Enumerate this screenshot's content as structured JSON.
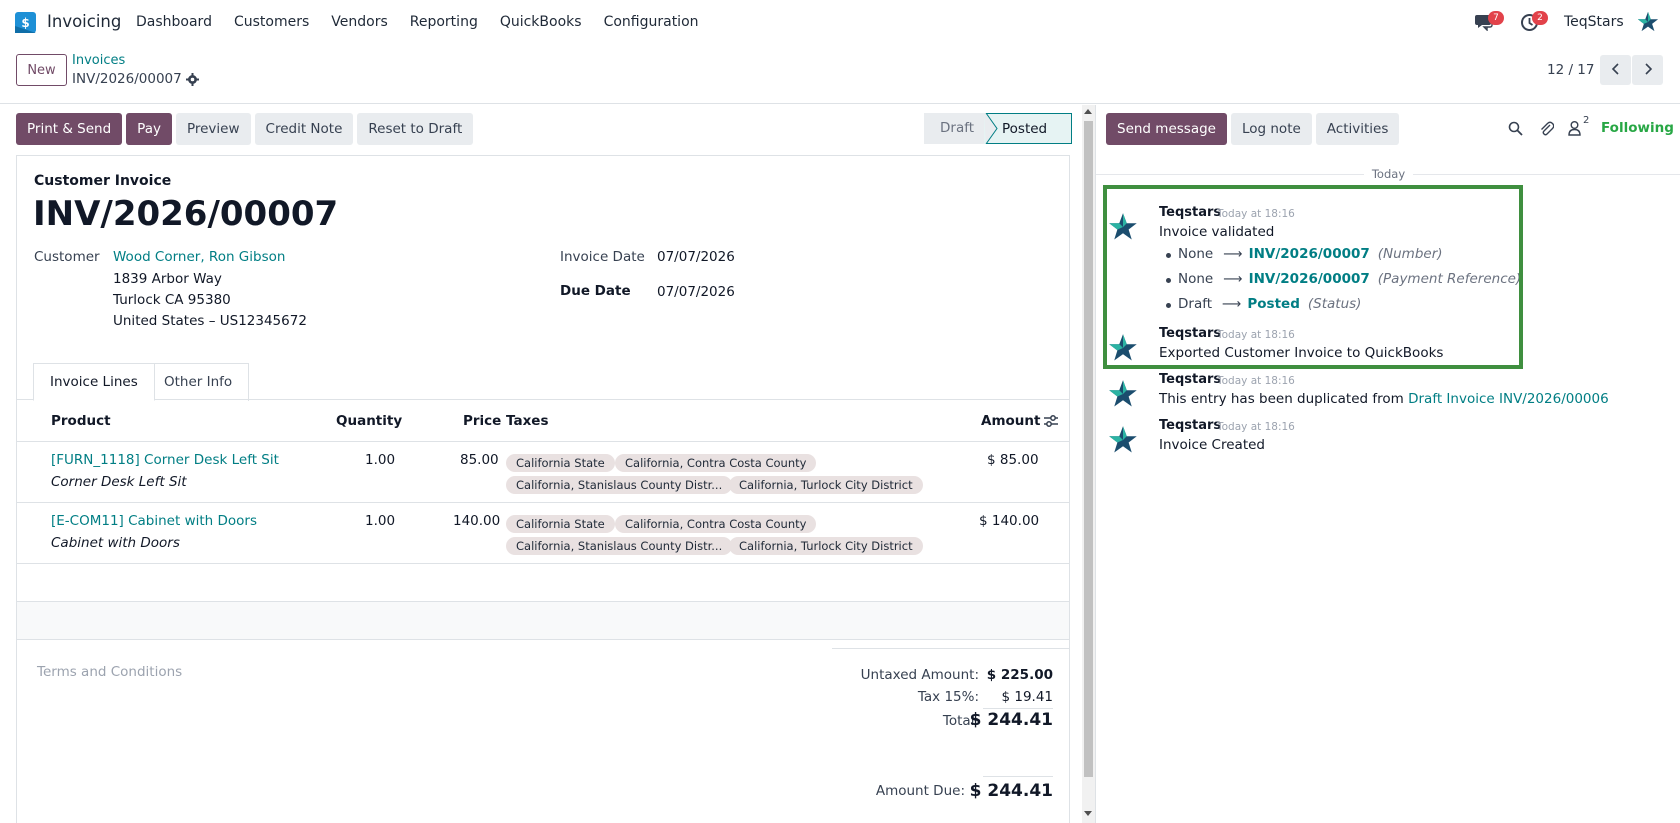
{
  "app": {
    "name": "Invoicing",
    "accent": "#714b67",
    "link_color": "#017e84"
  },
  "menu": [
    "Dashboard",
    "Customers",
    "Vendors",
    "Reporting",
    "QuickBooks",
    "Configuration"
  ],
  "systray": {
    "messages_count": "7",
    "activities_count": "2",
    "user": "TeqStars"
  },
  "control": {
    "new_label": "New",
    "breadcrumb_parent": "Invoices",
    "breadcrumb_current": "INV/2026/00007",
    "pager": "12 / 17"
  },
  "form_actions": {
    "print_send": "Print & Send",
    "pay": "Pay",
    "preview": "Preview",
    "credit_note": "Credit Note",
    "reset_draft": "Reset to Draft"
  },
  "status": {
    "draft": "Draft",
    "posted": "Posted"
  },
  "invoice": {
    "type": "Customer Invoice",
    "number": "INV/2026/00007",
    "customer_label": "Customer",
    "customer_name": "Wood Corner, Ron Gibson",
    "address": [
      "1839 Arbor Way",
      "Turlock CA 95380",
      "United States – US12345672"
    ],
    "invoice_date_label": "Invoice Date",
    "invoice_date": "07/07/2026",
    "due_date_label": "Due Date",
    "due_date": "07/07/2026"
  },
  "tabs": {
    "lines": "Invoice Lines",
    "other": "Other Info"
  },
  "columns": {
    "product": "Product",
    "quantity": "Quantity",
    "price": "Price",
    "taxes": "Taxes",
    "amount": "Amount"
  },
  "lines": [
    {
      "product": "[FURN_1118] Corner Desk Left Sit",
      "description": "Corner Desk Left Sit",
      "quantity": "1.00",
      "price": "85.00",
      "taxes": [
        "California State",
        "California, Contra Costa County",
        "California, Stanislaus County Distr...",
        "California, Turlock City District"
      ],
      "amount": "$ 85.00"
    },
    {
      "product": "[E-COM11] Cabinet with Doors",
      "description": "Cabinet with Doors",
      "quantity": "1.00",
      "price": "140.00",
      "taxes": [
        "California State",
        "California, Contra Costa County",
        "California, Stanislaus County Distr...",
        "California, Turlock City District"
      ],
      "amount": "$ 140.00"
    }
  ],
  "terms_placeholder": "Terms and Conditions",
  "totals": {
    "untaxed_label": "Untaxed Amount:",
    "untaxed": "$ 225.00",
    "tax_label": "Tax 15%:",
    "tax": "$ 19.41",
    "total_label": "Total:",
    "total": "$ 244.41",
    "due_label": "Amount Due:",
    "due": "$ 244.41"
  },
  "chatter": {
    "send_message": "Send message",
    "log_note": "Log note",
    "activities": "Activities",
    "followers_count": "2",
    "following": "Following",
    "date_separator": "Today",
    "messages": [
      {
        "author": "Teqstars",
        "time": "Today at 18:16",
        "body": "Invoice validated",
        "tracking": [
          {
            "old": "None",
            "new": "INV/2026/00007",
            "field": "(Number)"
          },
          {
            "old": "None",
            "new": "INV/2026/00007",
            "field": "(Payment Reference)"
          },
          {
            "old": "Draft",
            "new": "Posted",
            "field": "(Status)"
          }
        ]
      },
      {
        "author": "Teqstars",
        "time": "Today at 18:16",
        "body": "Exported Customer Invoice to QuickBooks"
      },
      {
        "author": "Teqstars",
        "time": "Today at 18:16",
        "body": "This entry has been duplicated from ",
        "link": "Draft Invoice INV/2026/00006"
      },
      {
        "author": "Teqstars",
        "time": "Today at 18:16",
        "body": "Invoice Created"
      }
    ]
  }
}
